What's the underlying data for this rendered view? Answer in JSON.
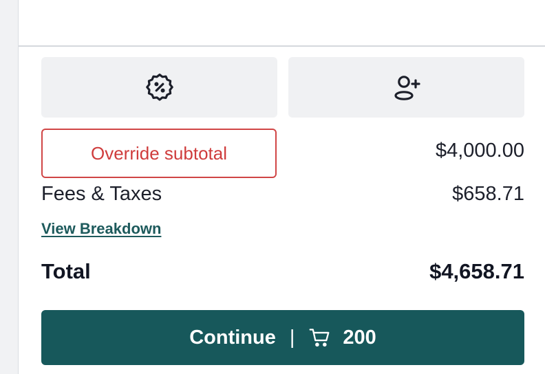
{
  "actions": {
    "discount_icon": "discount-badge-icon",
    "add_customer_icon": "add-user-icon"
  },
  "summary": {
    "override_label": "Override subtotal",
    "subtotal_value": "$4,000.00",
    "fees_label": "Fees & Taxes",
    "fees_value": "$658.71",
    "breakdown_link": "View Breakdown",
    "total_label": "Total",
    "total_value": "$4,658.71"
  },
  "checkout": {
    "continue_label": "Continue",
    "separator": "|",
    "cart_icon": "cart-icon",
    "cart_count": "200"
  },
  "colors": {
    "primary": "#17585b",
    "danger": "#cf3c3c",
    "panel": "#f0f1f3",
    "text": "#1c1f2a"
  }
}
